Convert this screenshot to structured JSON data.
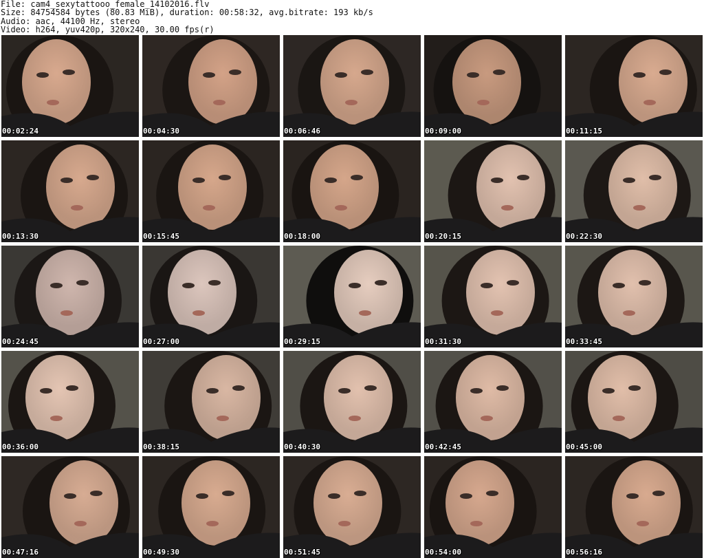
{
  "header": {
    "file_line": "File: cam4_sexytattooo_female_14102016.flv",
    "size_line": "Size: 84754584 bytes (80.83 MiB), duration: 00:58:32, avg.bitrate: 193 kb/s",
    "audio_line": "Audio: aac, 44100 Hz, stereo",
    "video_line": "Video: h264, yuv420p, 320x240, 30.00 fps(r)"
  },
  "thumbnails": [
    {
      "time": "00:02:24",
      "bg": "#2b2622",
      "skin": "#d8a98e",
      "hair": "#1a1512"
    },
    {
      "time": "00:04:30",
      "bg": "#2e2723",
      "skin": "#d3a287",
      "hair": "#1b1613"
    },
    {
      "time": "00:06:46",
      "bg": "#2d2724",
      "skin": "#d6a88d",
      "hair": "#1a1613"
    },
    {
      "time": "00:09:00",
      "bg": "#221d1a",
      "skin": "#c89a7f",
      "hair": "#151210"
    },
    {
      "time": "00:11:15",
      "bg": "#2c2622",
      "skin": "#d9ab90",
      "hair": "#1a1512"
    },
    {
      "time": "00:13:30",
      "bg": "#2c2622",
      "skin": "#d7a98e",
      "hair": "#1a1512"
    },
    {
      "time": "00:15:45",
      "bg": "#2b2521",
      "skin": "#d6a78b",
      "hair": "#1a1512"
    },
    {
      "time": "00:18:00",
      "bg": "#2a2420",
      "skin": "#d5a68a",
      "hair": "#191411"
    },
    {
      "time": "00:20:15",
      "bg": "#5c5a50",
      "skin": "#e2c2b0",
      "hair": "#1c1714"
    },
    {
      "time": "00:22:30",
      "bg": "#5a5850",
      "skin": "#e0bea9",
      "hair": "#1d1815"
    },
    {
      "time": "00:24:45",
      "bg": "#3a3834",
      "skin": "#cfb6ad",
      "hair": "#1b1715"
    },
    {
      "time": "00:27:00",
      "bg": "#3a3733",
      "skin": "#dcc6bd",
      "hair": "#1a1614"
    },
    {
      "time": "00:29:15",
      "bg": "#5d5b52",
      "skin": "#e6cdbf",
      "hair": "#0f0e0d"
    },
    {
      "time": "00:31:30",
      "bg": "#56544b",
      "skin": "#e3c3b1",
      "hair": "#1c1714"
    },
    {
      "time": "00:33:45",
      "bg": "#58564d",
      "skin": "#e1c0ad",
      "hair": "#1c1714"
    },
    {
      "time": "00:36:00",
      "bg": "#54524a",
      "skin": "#e4c5b3",
      "hair": "#1b1613"
    },
    {
      "time": "00:38:15",
      "bg": "#3f3c37",
      "skin": "#d9b7a3",
      "hair": "#1b1613"
    },
    {
      "time": "00:40:30",
      "bg": "#504e47",
      "skin": "#e2c1ae",
      "hair": "#1b1613"
    },
    {
      "time": "00:42:45",
      "bg": "#525049",
      "skin": "#dfbba6",
      "hair": "#1b1613"
    },
    {
      "time": "00:45:00",
      "bg": "#4e4c45",
      "skin": "#e1bea9",
      "hair": "#1b1613"
    },
    {
      "time": "00:47:16",
      "bg": "#2e2824",
      "skin": "#d7ac93",
      "hair": "#1a1512"
    },
    {
      "time": "00:49:30",
      "bg": "#2c2622",
      "skin": "#d8ab90",
      "hair": "#1a1512"
    },
    {
      "time": "00:51:45",
      "bg": "#2d2723",
      "skin": "#d9ad93",
      "hair": "#1a1512"
    },
    {
      "time": "00:54:00",
      "bg": "#2b2521",
      "skin": "#d6a88e",
      "hair": "#191411"
    },
    {
      "time": "00:56:16",
      "bg": "#2c2622",
      "skin": "#d8aa8f",
      "hair": "#1a1512"
    }
  ]
}
